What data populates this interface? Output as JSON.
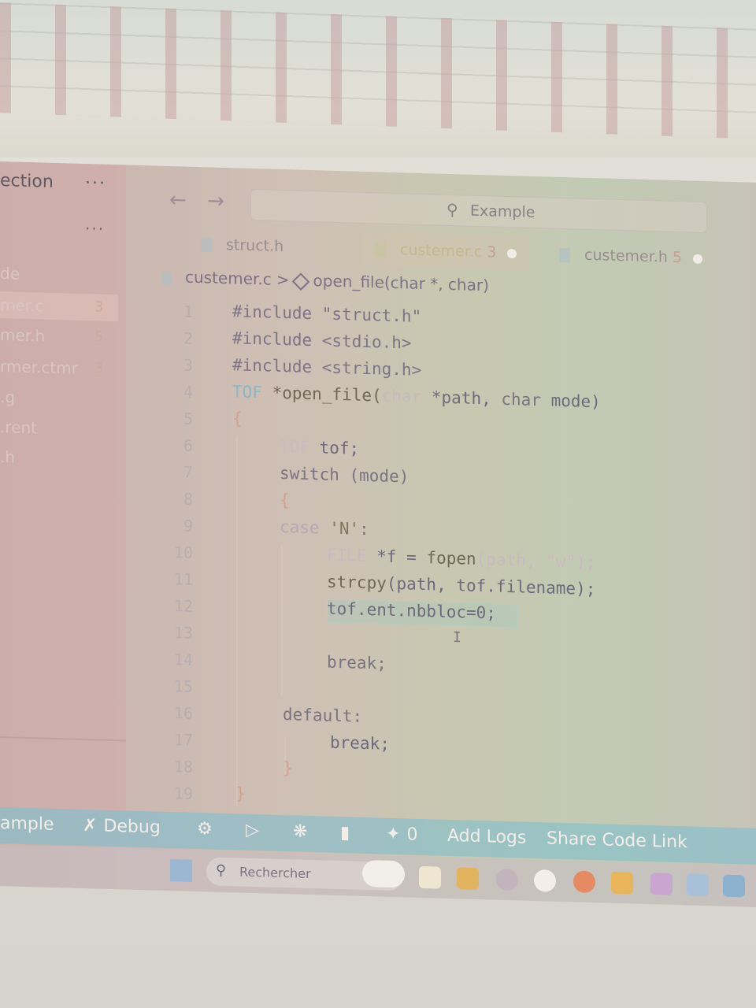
{
  "sidebar": {
    "title": "ection",
    "more": "···",
    "sub_more": "···",
    "section_label": "de",
    "items": [
      {
        "name": "mer.c",
        "count": "3",
        "active": true
      },
      {
        "name": "mer.h",
        "count": "5",
        "active": false
      },
      {
        "name": "rmer.ctmr",
        "count": "3",
        "active": false
      },
      {
        "name": ".g",
        "count": "",
        "active": false
      },
      {
        "name": ".rent",
        "count": "",
        "active": false
      },
      {
        "name": ".h",
        "count": "",
        "active": false
      }
    ]
  },
  "nav": {
    "back": "←",
    "forward": "→"
  },
  "search": {
    "icon": "search-icon",
    "label": "Example"
  },
  "tabs": [
    {
      "label": "struct.h",
      "badge": "",
      "dirty": false,
      "active": false
    },
    {
      "label": "custemer.c",
      "badge": "3",
      "dirty": true,
      "active": true
    },
    {
      "label": "custemer.h",
      "badge": "5",
      "dirty": true,
      "active": false
    }
  ],
  "breadcrumb": {
    "file": "custemer.c",
    "separator": ">",
    "symbol": "open_file(char *, char)"
  },
  "code": {
    "line_numbers": [
      "1",
      "2",
      "3",
      "4",
      "5",
      "6",
      "7",
      "8",
      "9",
      "10",
      "11",
      "12",
      "13",
      "14",
      "15",
      "16",
      "17",
      "18",
      "19"
    ],
    "lines": {
      "l1": "#include \"struct.h\"",
      "l2": "#include <stdio.h>",
      "l3": "#include <string.h>",
      "l4_type": "TOF",
      "l4_rest": " *open_file(",
      "l4_char1": "char",
      "l4_path": " *path, ",
      "l4_char2": "char",
      "l4_mode": " mode)",
      "l5": "{",
      "l6_type": "TOF",
      "l6_rest": " tof;",
      "l7": "switch (mode)",
      "l8": "{",
      "l9_kw": "case ",
      "l9_val": "'N'",
      "l9_colon": ":",
      "l10_type": "FILE",
      "l10_rest": " *f = ",
      "l10_fn": "fopen",
      "l10_args": "(path, \"w\");",
      "l11_fn": "strcpy",
      "l11_args": "(path, tof.filename);",
      "l12": "tof.ent.nbbloc=0;",
      "l14": "break;",
      "l16": "default:",
      "l17": "break;",
      "l18": "}",
      "l19": "}"
    },
    "cursor": "I"
  },
  "statusbar": {
    "example": "ample",
    "debug": "Debug",
    "zero": "0",
    "add_logs": "Add Logs",
    "share": "Share Code Link"
  },
  "taskbar": {
    "search_label": "Rechercher"
  }
}
